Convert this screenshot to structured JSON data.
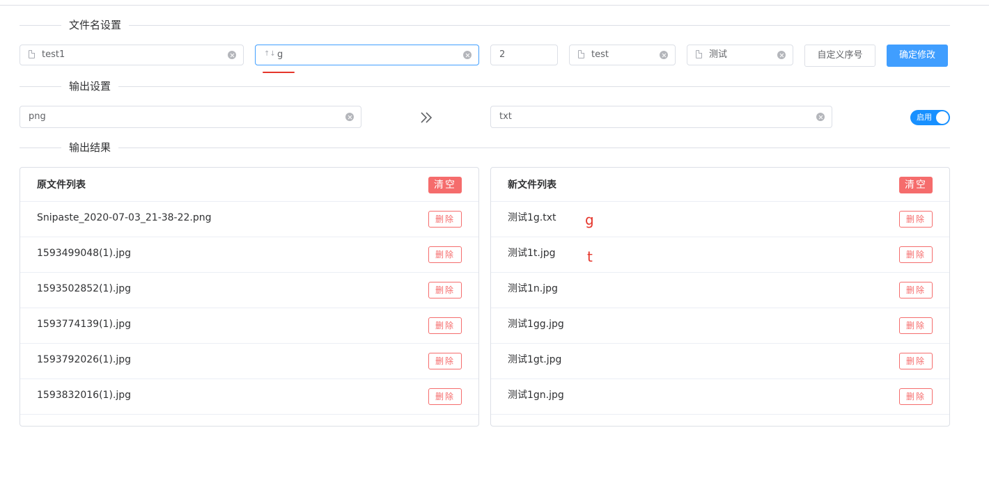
{
  "sections": {
    "filename_settings": "文件名设置",
    "output_settings": "输出设置",
    "output_results": "输出结果"
  },
  "filename": {
    "base_name": "test1",
    "sort_field": "g",
    "start_number": "2",
    "prefix": "test",
    "suffix": "测试",
    "custom_sequence_label": "自定义序号",
    "confirm_label": "确定修改"
  },
  "output": {
    "source_ext": "png",
    "target_ext": "txt",
    "toggle_label": "启用",
    "toggle_on": true
  },
  "original_list": {
    "title": "原文件列表",
    "clear_label": "清空",
    "delete_label": "删除",
    "files": [
      "Snipaste_2020-07-03_21-38-22.png",
      "1593499048(1).jpg",
      "1593502852(1).jpg",
      "1593774139(1).jpg",
      "1593792026(1).jpg",
      "1593832016(1).jpg"
    ]
  },
  "new_list": {
    "title": "新文件列表",
    "clear_label": "清空",
    "delete_label": "删除",
    "files": [
      "测试1g.txt",
      "测试1t.jpg",
      "测试1n.jpg",
      "测试1gg.jpg",
      "测试1gt.jpg",
      "测试1gn.jpg"
    ]
  },
  "annotations": [
    "g",
    "t"
  ],
  "colors": {
    "primary": "#409eff",
    "switch": "#1890ff",
    "danger": "#f56c6c",
    "annotation_red": "#e5352b"
  }
}
